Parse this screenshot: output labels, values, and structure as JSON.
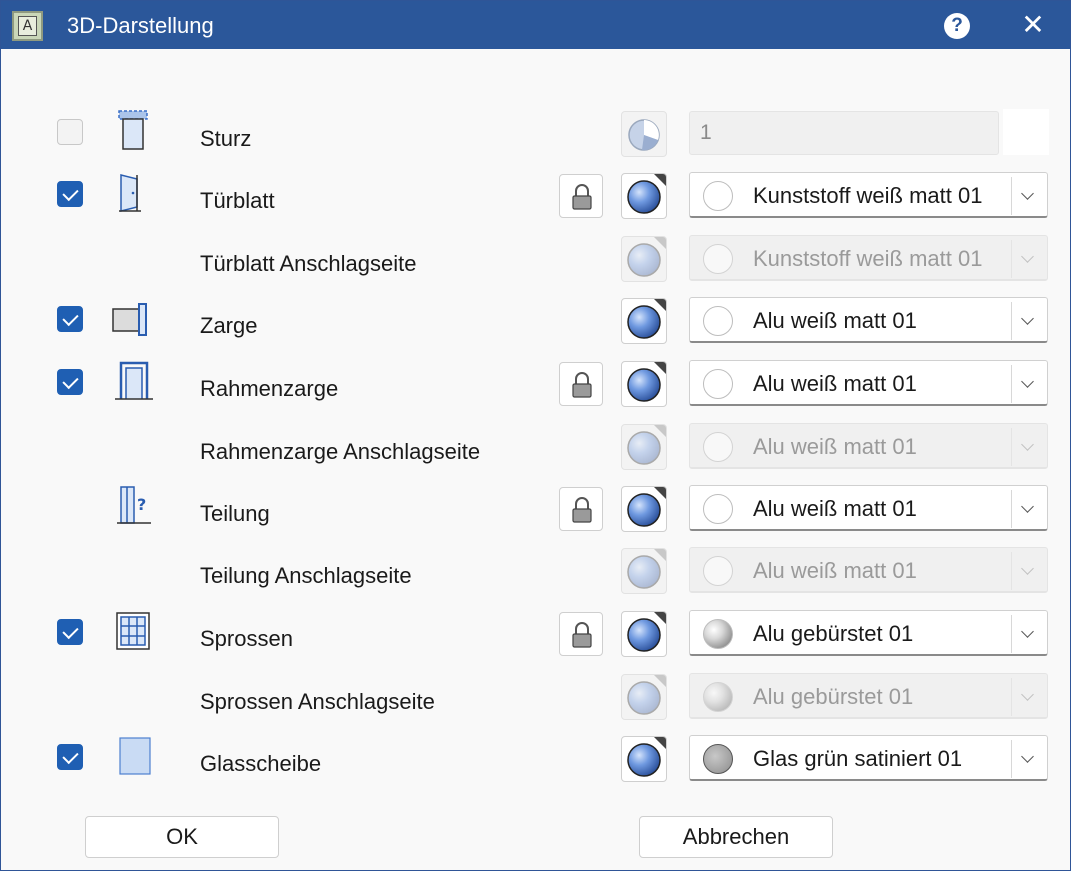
{
  "window": {
    "title": "3D-Darstellung",
    "app_icon": "app-icon",
    "help_glyph": "?",
    "close_glyph": "✕"
  },
  "colors": {
    "titlebar": "#2b579a",
    "checkbox_checked": "#1f5fb3",
    "material_blue": "#5b86d6"
  },
  "rows": [
    {
      "name": "sturz",
      "checked": false,
      "icon": "lintel-icon",
      "label": "Sturz",
      "lock": false,
      "material_enabled": false,
      "field": "number",
      "value": "1"
    },
    {
      "name": "tuerblatt",
      "checked": true,
      "icon": "door-leaf-icon",
      "label": "Türblatt",
      "lock": true,
      "material_enabled": true,
      "swatch": "white",
      "value": "Kunststoff weiß matt 01"
    },
    {
      "name": "tuerblatt-anschlagseite",
      "checked": null,
      "icon": "",
      "label": "Türblatt Anschlagseite",
      "lock": false,
      "material_enabled": false,
      "swatch": "white",
      "value": "Kunststoff weiß matt 01"
    },
    {
      "name": "zarge",
      "checked": true,
      "icon": "frame-icon",
      "label": "Zarge",
      "lock": false,
      "material_enabled": true,
      "swatch": "white",
      "value": "Alu weiß matt 01"
    },
    {
      "name": "rahmenzarge",
      "checked": true,
      "icon": "frame-door-icon",
      "label": "Rahmenzarge",
      "lock": true,
      "material_enabled": true,
      "swatch": "white",
      "value": "Alu weiß matt 01"
    },
    {
      "name": "rahmenzarge-anschlagseite",
      "checked": null,
      "icon": "",
      "label": "Rahmenzarge Anschlagseite",
      "lock": false,
      "material_enabled": false,
      "swatch": "white",
      "value": "Alu weiß matt 01"
    },
    {
      "name": "teilung",
      "checked": null,
      "icon": "division-icon",
      "label": "Teilung",
      "lock": true,
      "material_enabled": true,
      "swatch": "white",
      "value": "Alu weiß matt 01"
    },
    {
      "name": "teilung-anschlagseite",
      "checked": null,
      "icon": "",
      "label": "Teilung Anschlagseite",
      "lock": false,
      "material_enabled": false,
      "swatch": "white",
      "value": "Alu weiß matt 01"
    },
    {
      "name": "sprossen",
      "checked": true,
      "icon": "muntin-icon",
      "label": "Sprossen",
      "lock": true,
      "material_enabled": true,
      "swatch": "metal",
      "value": "Alu gebürstet 01"
    },
    {
      "name": "sprossen-anschlagseite",
      "checked": null,
      "icon": "",
      "label": "Sprossen Anschlagseite",
      "lock": false,
      "material_enabled": false,
      "swatch": "metal",
      "value": "Alu gebürstet 01"
    },
    {
      "name": "glasscheibe",
      "checked": true,
      "icon": "glass-pane-icon",
      "label": "Glasscheibe",
      "lock": false,
      "material_enabled": true,
      "swatch": "grey",
      "value": "Glas grün satiniert 01"
    }
  ],
  "buttons": {
    "ok": "OK",
    "cancel": "Abbrechen"
  }
}
